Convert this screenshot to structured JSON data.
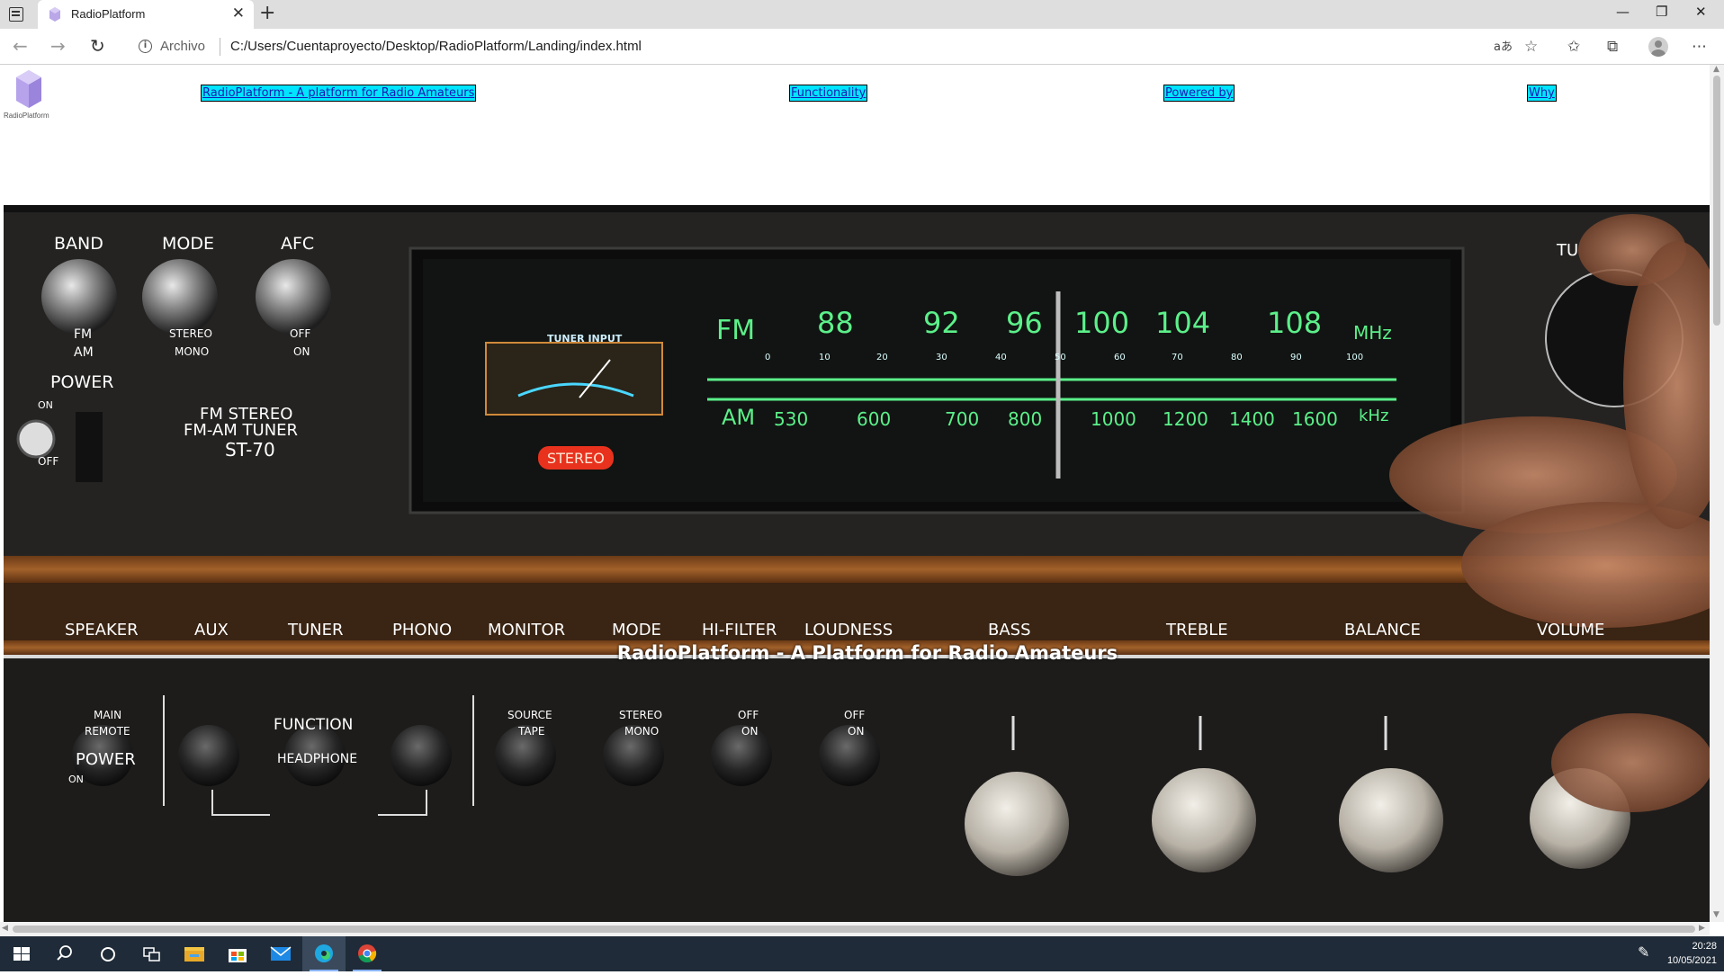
{
  "browser": {
    "tab_title": "RadioPlatform",
    "tab_close_glyph": "✕",
    "new_tab_glyph": "+",
    "address_scheme_label": "Archivo",
    "address_url": "C:/Users/Cuentaproyecto/Desktop/RadioPlatform/Landing/index.html",
    "window_controls": {
      "minimize": "—",
      "restore": "❐",
      "close": "✕"
    }
  },
  "site": {
    "logo_text": "RadioPlatform",
    "nav": [
      {
        "label": "RadioPlatform - A platform for Radio Amateurs"
      },
      {
        "label": "Functionality"
      },
      {
        "label": "Powered by"
      },
      {
        "label": "Why"
      }
    ],
    "hero": {
      "caption": "RadioPlatform - A Platform for Radio Amateurs",
      "tuner_panel": {
        "controls": [
          "BAND",
          "MODE",
          "AFC"
        ],
        "band_options": [
          "FM",
          "AM"
        ],
        "mode_options": [
          "STEREO",
          "MONO"
        ],
        "afc_options": [
          "OFF",
          "ON"
        ],
        "power_label": "POWER",
        "power_on": "ON",
        "power_off": "OFF",
        "model_lines": [
          "FM STEREO",
          "FM-AM TUNER",
          "ST-70"
        ],
        "meter_label": "TUNER INPUT",
        "stereo_indicator": "STEREO",
        "fm_label": "FM",
        "am_label": "AM",
        "fm_scale": [
          "88",
          "92",
          "96",
          "100",
          "104",
          "108"
        ],
        "fm_unit": "MHz",
        "linear_scale": [
          "0",
          "10",
          "20",
          "30",
          "40",
          "50",
          "60",
          "70",
          "80",
          "90",
          "100"
        ],
        "am_scale": [
          "530",
          "600",
          "700",
          "800",
          "1000",
          "1200",
          "1400",
          "1600"
        ],
        "am_unit": "kHz",
        "tuning_label": "TU"
      },
      "amp_panel": {
        "labels": [
          "SPEAKER",
          "AUX",
          "TUNER",
          "PHONO",
          "MONITOR",
          "MODE",
          "HI-FILTER",
          "LOUDNESS",
          "BASS",
          "TREBLE",
          "BALANCE",
          "VOLUME"
        ],
        "speaker_options": [
          "MAIN",
          "REMOTE"
        ],
        "function_label": "FUNCTION",
        "monitor_row_top": [
          "SOURCE",
          "STEREO",
          "OFF",
          "OFF"
        ],
        "monitor_row_bottom": [
          "TAPE",
          "MONO",
          "ON",
          "ON"
        ],
        "power_label": "POWER",
        "power_on": "ON",
        "headphone_label": "HEADPHONE"
      }
    }
  },
  "taskbar": {
    "time": "20:28",
    "date": "10/05/2021",
    "apps": [
      "windows-start",
      "search",
      "cortana",
      "task-view",
      "file-explorer",
      "microsoft-store",
      "mail",
      "edge",
      "chrome"
    ]
  },
  "colors": {
    "nav_link_bg": "#00e5ff",
    "nav_link_text": "#1a1ab0",
    "dial_green": "#5cf08a",
    "stereo_red": "#e8321e",
    "taskbar_bg": "#1f2b38"
  }
}
